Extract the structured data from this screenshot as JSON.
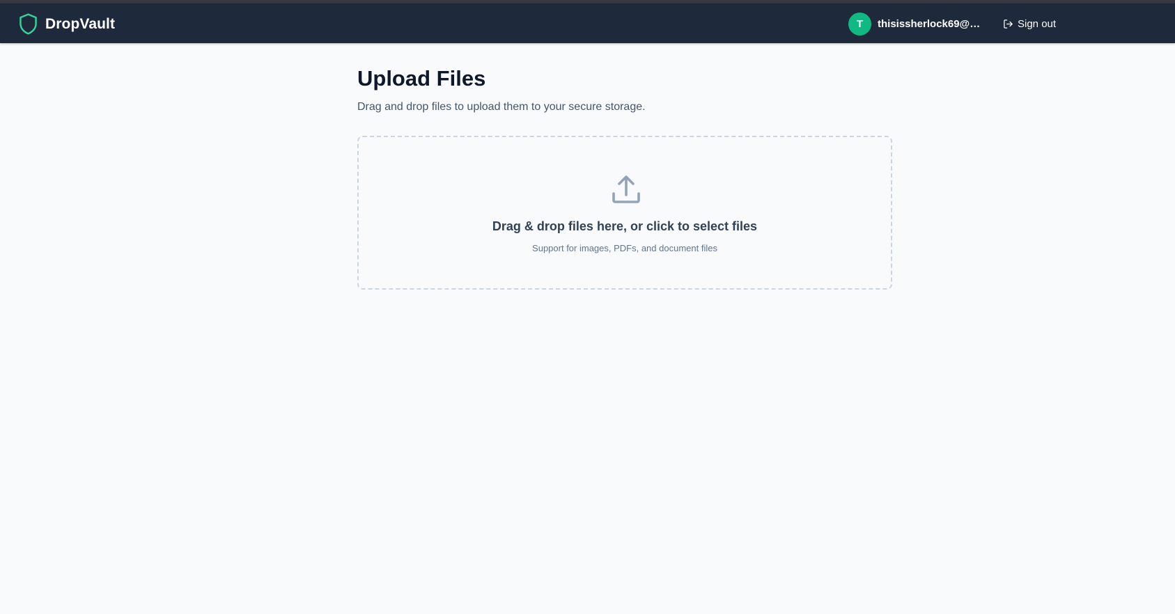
{
  "app": {
    "name": "DropVault",
    "logo_icon": "shield-icon",
    "brand_color": "#34d399",
    "navbar_color": "#1e293b"
  },
  "user": {
    "avatar_initial": "T",
    "avatar_color": "#10b981",
    "email": "thisissherlock69@gm..."
  },
  "nav": {
    "signout_label": "Sign out",
    "signout_icon": "log-out-icon"
  },
  "page": {
    "title": "Upload Files",
    "subtitle": "Drag and drop files to upload them to your secure storage."
  },
  "dropzone": {
    "icon": "upload-icon",
    "title": "Drag & drop files here, or click to select files",
    "subtitle": "Support for images, PDFs, and document files"
  }
}
